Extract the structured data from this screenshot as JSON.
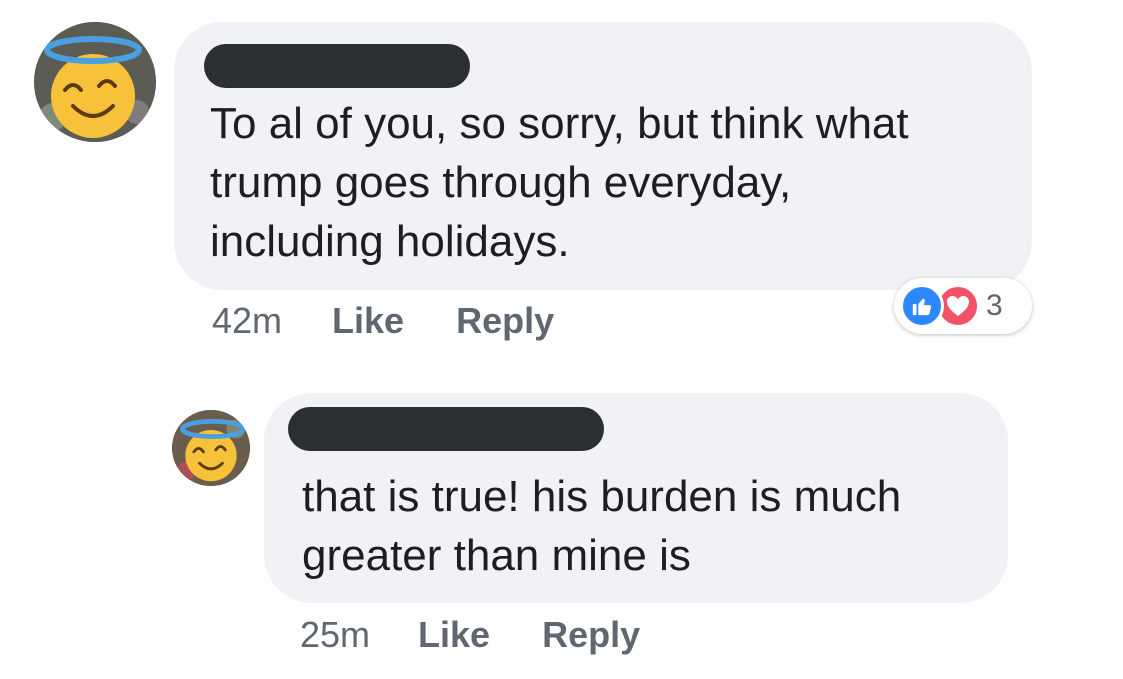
{
  "comments": [
    {
      "text": "To al of you, so sorry, but think what\ntrump goes through everyday,\nincluding holidays.",
      "time": "42m",
      "like_label": "Like",
      "reply_label": "Reply",
      "reactions": {
        "icons": [
          "like-icon",
          "love-icon"
        ],
        "count": "3"
      }
    },
    {
      "text": "that is true! his burden is much\ngreater than mine is",
      "time": "25m",
      "like_label": "Like",
      "reply_label": "Reply"
    }
  ],
  "colors": {
    "bubble": "#f1f2f6",
    "meta_text": "#606770",
    "comment_text": "#1c1e21",
    "redaction": "#2b2e33",
    "like_blue": "#2d88ff",
    "love_red": "#f25268",
    "halo": "#4a9fe0",
    "face": "#f7c23a"
  }
}
